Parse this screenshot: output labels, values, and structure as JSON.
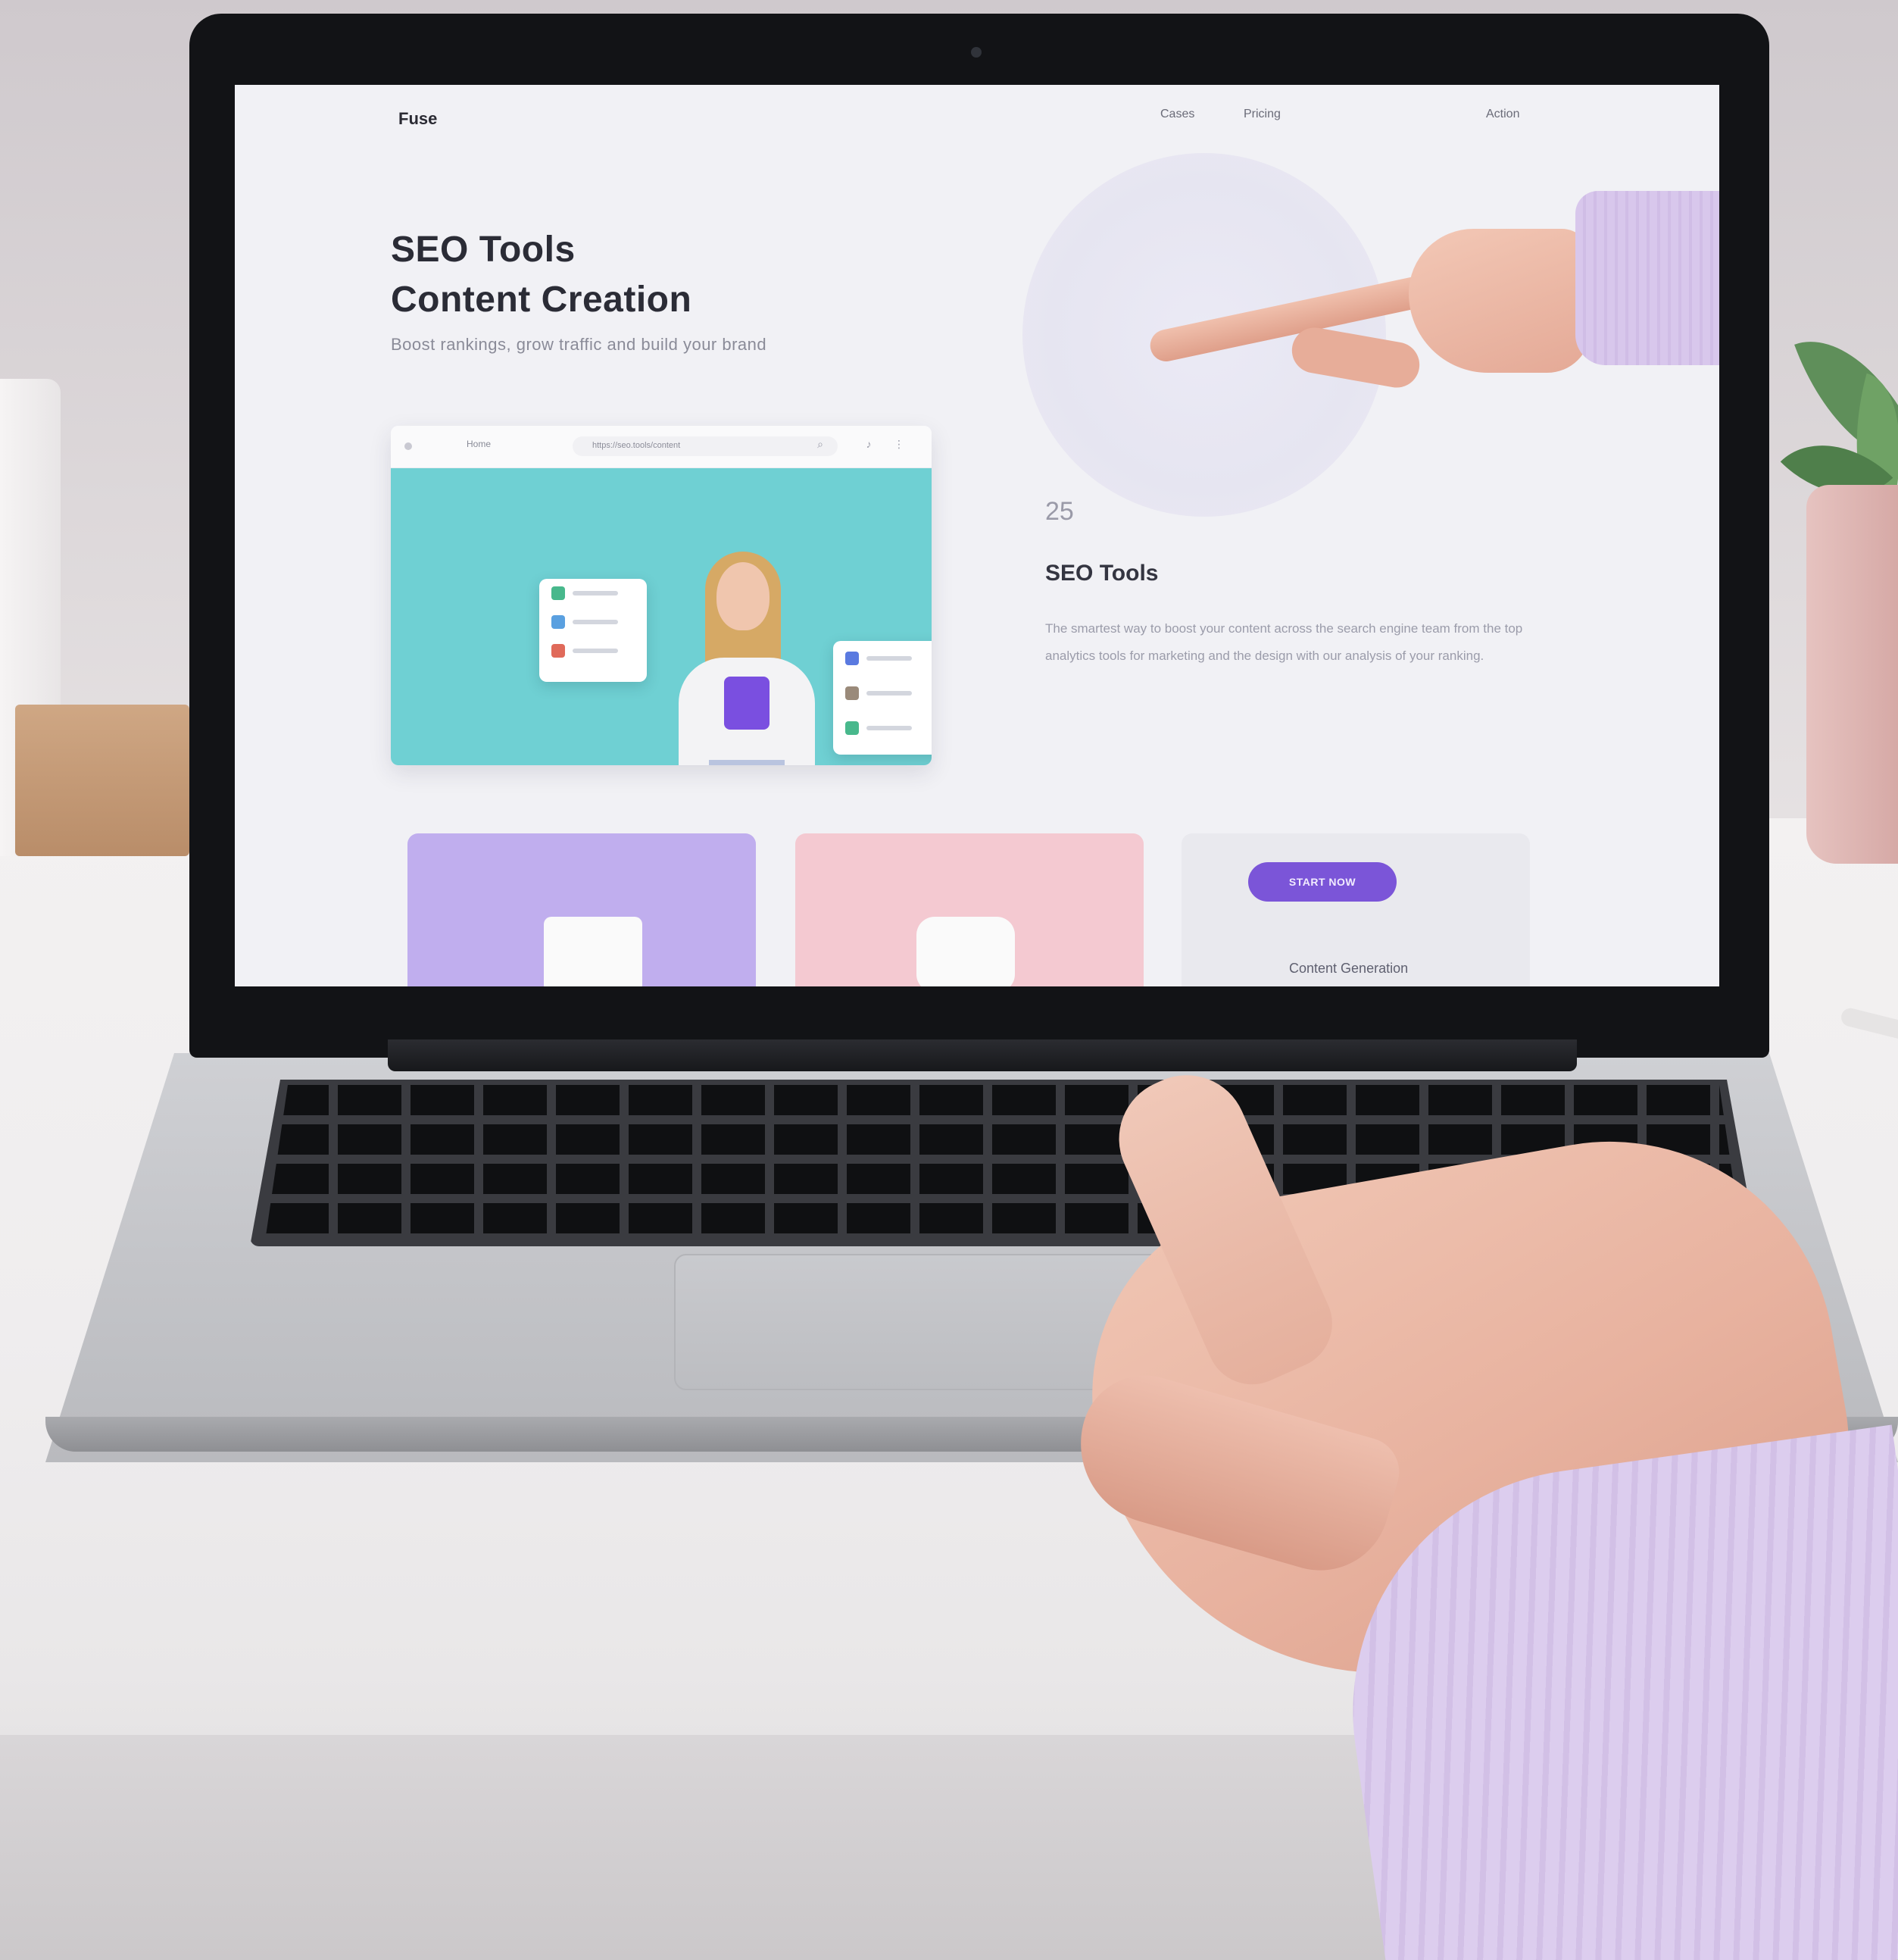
{
  "site": {
    "logo": "Fuse",
    "nav": [
      "Cases",
      "Pricing",
      "",
      "Action"
    ]
  },
  "hero": {
    "title_line1": "SEO Tools",
    "title_line2": "Content Creation",
    "subtitle": "Boost rankings, grow traffic and build your brand"
  },
  "mockup": {
    "tab_label": "Home",
    "url": "https://seo.tools/content"
  },
  "feature": {
    "number": "25",
    "title": "SEO Tools",
    "text": "The smartest way to boost your content across the search engine team from the top analytics tools for marketing and the design with our analysis of your ranking."
  },
  "cta": {
    "button_label": "START NOW",
    "subtitle": "Content Generation"
  },
  "colors": {
    "accent": "#7b55d8",
    "teal": "#6fd0d3",
    "lavender": "#c0aeee",
    "pink": "#f4c9d1"
  }
}
